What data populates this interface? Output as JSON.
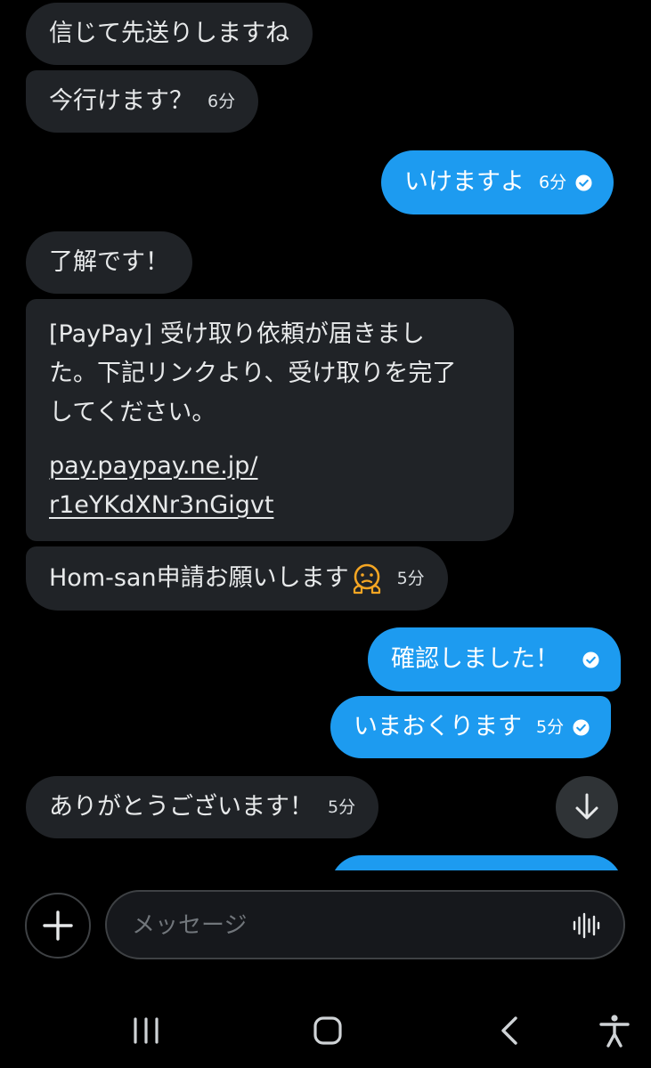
{
  "colors": {
    "background": "#000000",
    "incoming_bubble": "#202327",
    "outgoing_bubble": "#1d9bf0",
    "text": "#e7e9ea"
  },
  "messages": [
    {
      "direction": "incoming",
      "text": "信じて先送りしますね",
      "time": ""
    },
    {
      "direction": "incoming",
      "text": "今行けます？",
      "time": "6分"
    },
    {
      "direction": "outgoing",
      "text": "いけますよ",
      "time": "6分",
      "read": true
    },
    {
      "direction": "incoming",
      "text": "了解です！",
      "time": ""
    },
    {
      "direction": "incoming",
      "lines": [
        "[PayPay] 受け取り依頼が届きまし",
        "た。下記リンクより、受け取りを完了",
        "してください。"
      ],
      "link_lines": [
        "pay.paypay.ne.jp/",
        "r1eYKdXNr3nGigvt"
      ]
    },
    {
      "direction": "incoming",
      "text": "Hom-san申請お願いします",
      "emoji": "pleading-face",
      "time": "5分"
    },
    {
      "direction": "outgoing",
      "text": "確認しました！",
      "time": "",
      "read": true
    },
    {
      "direction": "outgoing",
      "text": "いまおくります",
      "time": "5分",
      "read": true
    },
    {
      "direction": "incoming",
      "text": "ありがとうございます！",
      "time": "5分"
    }
  ],
  "icons": {
    "scroll_down": "arrow-down-icon",
    "add": "plus-icon",
    "voice": "voice-waveform-icon",
    "read_receipt": "check-circle-icon",
    "nav_recent": "recent-apps-icon",
    "nav_home": "home-icon",
    "nav_back": "back-icon",
    "nav_accessibility": "accessibility-icon"
  },
  "composer": {
    "placeholder": "メッセージ"
  }
}
